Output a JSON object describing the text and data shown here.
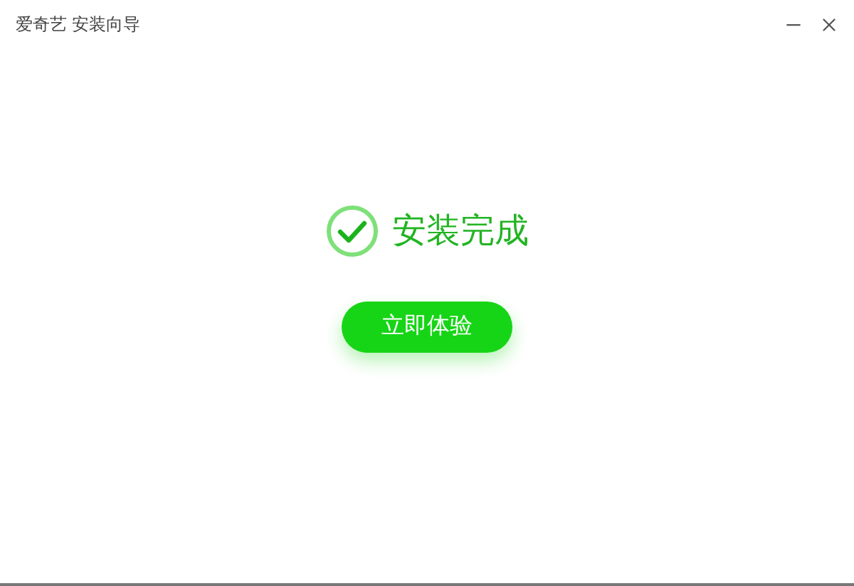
{
  "window": {
    "title": "爱奇艺 安装向导"
  },
  "status": {
    "message": "安装完成"
  },
  "button": {
    "label": "立即体验"
  }
}
